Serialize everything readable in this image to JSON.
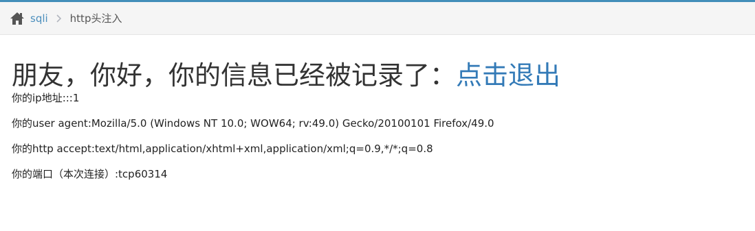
{
  "breadcrumb": {
    "home_icon": "home-icon",
    "parent_label": "sqli",
    "current_label": "http头注入"
  },
  "main": {
    "headline_text": "朋友，你好，你的信息已经被记录了：",
    "logout_label": "点击退出",
    "info_lines": [
      "你的ip地址:::1",
      "你的user agent:Mozilla/5.0 (Windows NT 10.0; WOW64; rv:49.0) Gecko/20100101 Firefox/49.0",
      "你的http accept:text/html,application/xhtml+xml,application/xml;q=0.9,*/*;q=0.8",
      "你的端口（本次连接）:tcp60314"
    ]
  },
  "colors": {
    "accent_top": "#438eb9",
    "link": "#337ab7",
    "breadcrumb_bg": "#f5f5f5"
  }
}
